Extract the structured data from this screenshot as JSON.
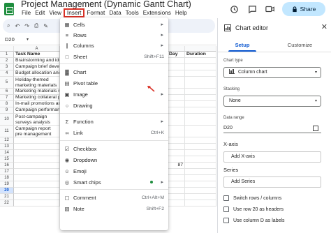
{
  "app": {
    "title": "Project Management (Dynamic Gantt Chart)",
    "menus": [
      "File",
      "Edit",
      "View",
      "Insert",
      "Format",
      "Data",
      "Tools",
      "Extensions",
      "Help"
    ],
    "active_menu": "Insert",
    "share_label": "Share",
    "accent_color": "#0b57d0",
    "highlight_color": "#d93025"
  },
  "formula_bar": {
    "cell_ref": "D20"
  },
  "grid": {
    "columns": [
      "A",
      "B"
    ],
    "visible_right_headers": [
      "Day",
      "Duration"
    ],
    "header_row": "Task Name",
    "tasks": [
      "Brainstorming and ide",
      "Campaign brief develo",
      "Budget allocation and",
      "Holiday-themed marketing materials design",
      "Marketing materials r",
      "Marketing collateral p",
      "In-mail promotions an",
      "Campaign performanc",
      "Post-campaign surveys analysis",
      "Campaign report pre management"
    ],
    "values_col_d": [
      "87"
    ],
    "row_numbers": [
      "1",
      "2",
      "3",
      "4",
      "5",
      "6",
      "7",
      "8",
      "9",
      "10",
      "11",
      "12",
      "13",
      "14",
      "15",
      "16",
      "17",
      "18",
      "19",
      "20",
      "21",
      "22"
    ],
    "selected_row": "20"
  },
  "insert_menu": {
    "items": [
      {
        "label": "Cells",
        "icon": "cells-icon",
        "arrow": "▸"
      },
      {
        "label": "Rows",
        "icon": "rows-icon",
        "arrow": "▸"
      },
      {
        "label": "Columns",
        "icon": "columns-icon",
        "arrow": "▸"
      },
      {
        "label": "Sheet",
        "icon": "sheet-icon",
        "shortcut": "Shift+F11"
      },
      {
        "label": "Chart",
        "icon": "chart-icon"
      },
      {
        "label": "Pivot table",
        "icon": "pivot-table-icon"
      },
      {
        "label": "Image",
        "icon": "image-icon",
        "arrow": "▸"
      },
      {
        "label": "Drawing",
        "icon": "drawing-icon"
      },
      {
        "label": "Function",
        "icon": "function-icon",
        "arrow": "▸"
      },
      {
        "label": "Link",
        "icon": "link-icon",
        "shortcut": "Ctrl+K"
      },
      {
        "label": "Checkbox",
        "icon": "checkbox-icon"
      },
      {
        "label": "Dropdown",
        "icon": "dropdown-icon"
      },
      {
        "label": "Emoji",
        "icon": "emoji-icon"
      },
      {
        "label": "Smart chips",
        "icon": "smart-chips-icon",
        "arrow": "▸"
      },
      {
        "label": "Comment",
        "icon": "comment-icon",
        "shortcut": "Ctrl+Alt+M"
      },
      {
        "label": "Note",
        "icon": "note-icon",
        "shortcut": "Shift+F2"
      }
    ]
  },
  "chart_editor": {
    "title": "Chart editor",
    "tabs": [
      "Setup",
      "Customize"
    ],
    "active_tab": "Setup",
    "chart_type_label": "Chart type",
    "chart_type_value": "Column chart",
    "stacking_label": "Stacking",
    "stacking_value": "None",
    "data_range_label": "Data range",
    "data_range_value": "D20",
    "x_axis_label": "X-axis",
    "x_axis_button": "Add X-axis",
    "series_label": "Series",
    "series_button": "Add Series",
    "checkboxes": [
      "Switch rows / columns",
      "Use row 20 as headers",
      "Use column D as labels"
    ]
  }
}
